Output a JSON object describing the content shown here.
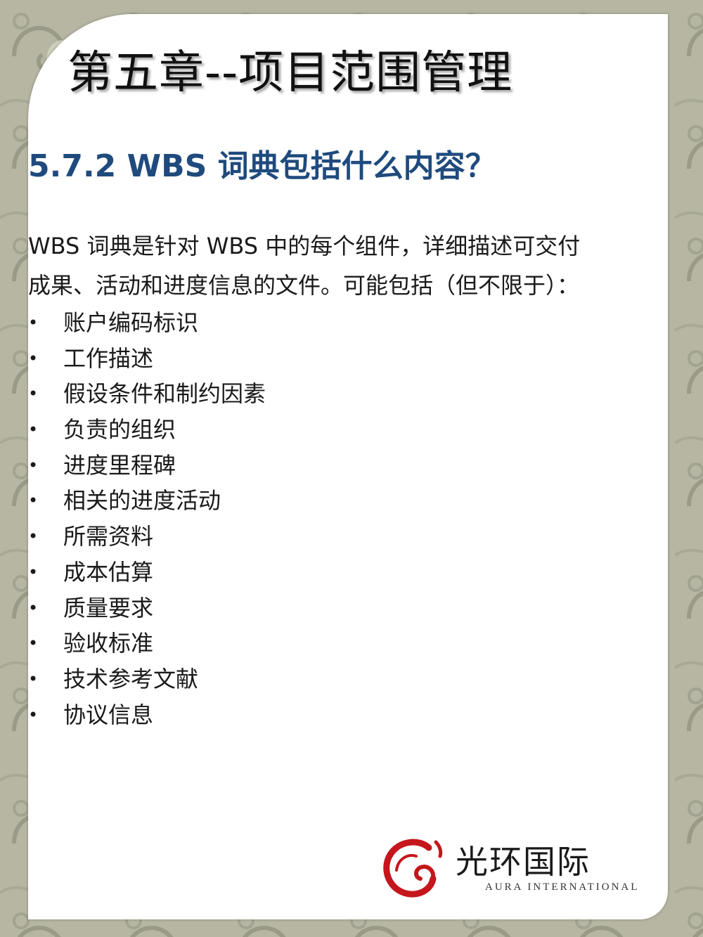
{
  "slide": {
    "chapter_title": "第五章--项目范围管理",
    "section_title": "5.7.2  WBS 词典包括什么内容？",
    "intro_line1": "WBS  词典是针对 WBS 中的每个组件，详细描述可交付",
    "intro_line2": "成果、活动和进度信息的文件。可能包括（但不限于）：",
    "bullet_symbol": "•",
    "items": [
      "账户编码标识",
      "工作描述",
      "假设条件和制约因素",
      "负责的组织",
      "进度里程碑",
      "相关的进度活动",
      "所需资料",
      "成本估算",
      "质量要求",
      "验收标准",
      "技术参考文献",
      "协议信息"
    ]
  },
  "logo": {
    "name": "光环国际",
    "subtitle": "AURA INTERNATIONAL",
    "mark_color": "#c4161c"
  },
  "colors": {
    "section_title": "#1f4a7d",
    "background": "#b8b8a6",
    "card": "#ffffff"
  }
}
